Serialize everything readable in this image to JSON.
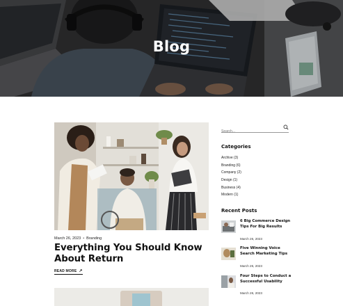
{
  "hero": {
    "title": "Blog"
  },
  "post": {
    "date": "March 26, 2023",
    "category": "Branding",
    "title": "Everything You Should Know About Return",
    "read_more": "READ MORE"
  },
  "sidebar": {
    "search_placeholder": "Search...",
    "categories_heading": "Categories",
    "categories": [
      "Archive (3)",
      "Branding (6)",
      "Company (2)",
      "Design (1)",
      "Business (4)",
      "Modern (1)"
    ],
    "recent_heading": "Recent Posts",
    "recent_posts": [
      {
        "title": "6 Big Commerce Design Tips For Big Results",
        "date": "March 26, 2023"
      },
      {
        "title": "Five Winning Voice Search Marketing Tips",
        "date": "March 26, 2023"
      },
      {
        "title": "Four Steps to Conduct a Successful Usability",
        "date": "March 26, 2023"
      }
    ]
  }
}
